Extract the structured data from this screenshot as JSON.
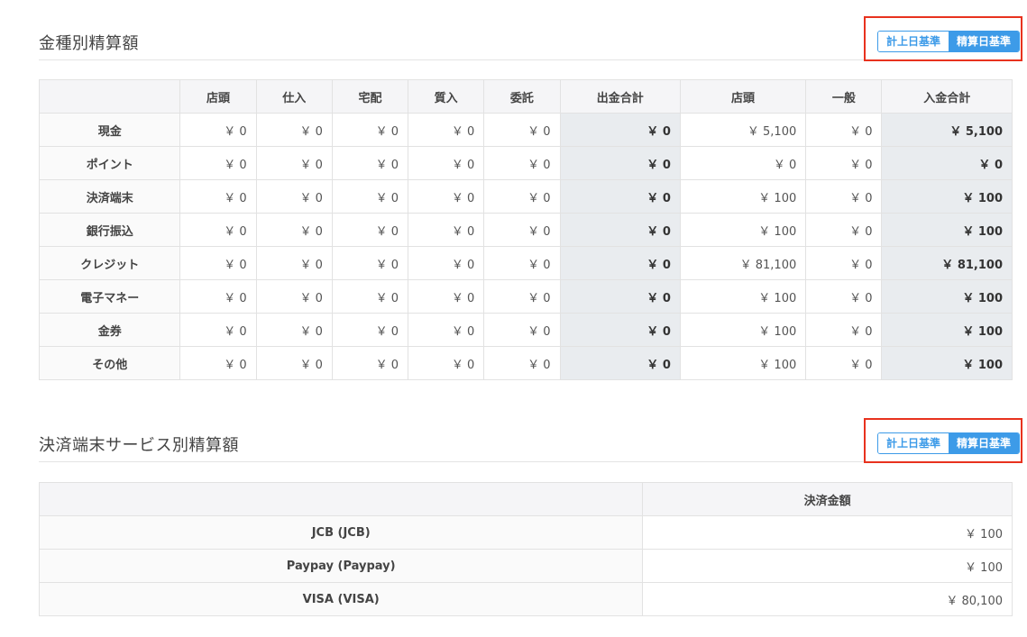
{
  "section1": {
    "title": "金種別精算額",
    "toggle": {
      "option_a": "計上日基準",
      "option_b": "精算日基準",
      "selected": "精算日基準"
    },
    "columns": [
      "",
      "店頭",
      "仕入",
      "宅配",
      "質入",
      "委託",
      "出金合計",
      "店頭",
      "一般",
      "入金合計"
    ],
    "rows": [
      {
        "label": "現金",
        "cells": [
          "￥ 0",
          "￥ 0",
          "￥ 0",
          "￥ 0",
          "￥ 0",
          "￥ 0",
          "￥ 5,100",
          "￥ 0",
          "￥ 5,100"
        ]
      },
      {
        "label": "ポイント",
        "cells": [
          "￥ 0",
          "￥ 0",
          "￥ 0",
          "￥ 0",
          "￥ 0",
          "￥ 0",
          "￥ 0",
          "￥ 0",
          "￥ 0"
        ]
      },
      {
        "label": "決済端末",
        "cells": [
          "￥ 0",
          "￥ 0",
          "￥ 0",
          "￥ 0",
          "￥ 0",
          "￥ 0",
          "￥ 100",
          "￥ 0",
          "￥ 100"
        ]
      },
      {
        "label": "銀行振込",
        "cells": [
          "￥ 0",
          "￥ 0",
          "￥ 0",
          "￥ 0",
          "￥ 0",
          "￥ 0",
          "￥ 100",
          "￥ 0",
          "￥ 100"
        ]
      },
      {
        "label": "クレジット",
        "cells": [
          "￥ 0",
          "￥ 0",
          "￥ 0",
          "￥ 0",
          "￥ 0",
          "￥ 0",
          "￥ 81,100",
          "￥ 0",
          "￥ 81,100"
        ]
      },
      {
        "label": "電子マネー",
        "cells": [
          "￥ 0",
          "￥ 0",
          "￥ 0",
          "￥ 0",
          "￥ 0",
          "￥ 0",
          "￥ 100",
          "￥ 0",
          "￥ 100"
        ]
      },
      {
        "label": "金券",
        "cells": [
          "￥ 0",
          "￥ 0",
          "￥ 0",
          "￥ 0",
          "￥ 0",
          "￥ 0",
          "￥ 100",
          "￥ 0",
          "￥ 100"
        ]
      },
      {
        "label": "その他",
        "cells": [
          "￥ 0",
          "￥ 0",
          "￥ 0",
          "￥ 0",
          "￥ 0",
          "￥ 0",
          "￥ 100",
          "￥ 0",
          "￥ 100"
        ]
      }
    ]
  },
  "section2": {
    "title": "決済端末サービス別精算額",
    "toggle": {
      "option_a": "計上日基準",
      "option_b": "精算日基準",
      "selected": "精算日基準"
    },
    "columns": [
      "",
      "決済金額"
    ],
    "rows": [
      {
        "label": "JCB (JCB)",
        "amount": "￥ 100"
      },
      {
        "label": "Paypay (Paypay)",
        "amount": "￥ 100"
      },
      {
        "label": "VISA (VISA)",
        "amount": "￥ 80,100"
      }
    ]
  },
  "colors": {
    "accent": "#3d9be8",
    "highlight_border": "#e8321e",
    "total_bg": "#e9ecef"
  }
}
